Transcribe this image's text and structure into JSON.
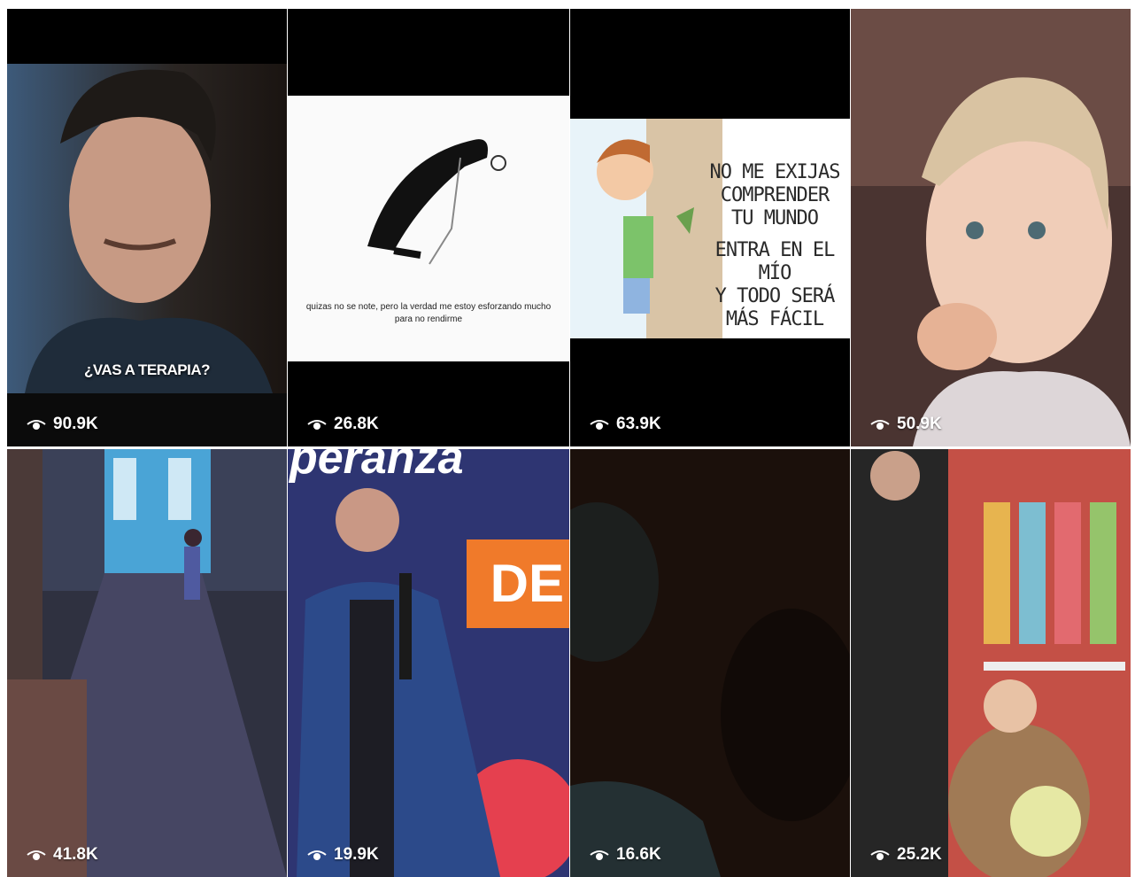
{
  "tiles": [
    {
      "views": "90.9K",
      "caption": "¿VAS A TERAPIA?"
    },
    {
      "views": "26.8K",
      "caption": "quizas no se note, pero la verdad me estoy esforzando mucho para no rendirme"
    },
    {
      "views": "63.9K",
      "caption_lines": [
        "NO ME EXIJAS",
        "COMPRENDER",
        "TU MUNDO",
        "ENTRA EN EL MÍO",
        "Y TODO SERÁ",
        "MÁS FÁCIL"
      ]
    },
    {
      "views": "50.9K"
    },
    {
      "views": "41.8K"
    },
    {
      "views": "19.9K",
      "banner": "peranza",
      "banner_tag": "DE"
    },
    {
      "views": "16.6K"
    },
    {
      "views": "25.2K"
    }
  ],
  "icons": {
    "views": "eye-icon"
  }
}
